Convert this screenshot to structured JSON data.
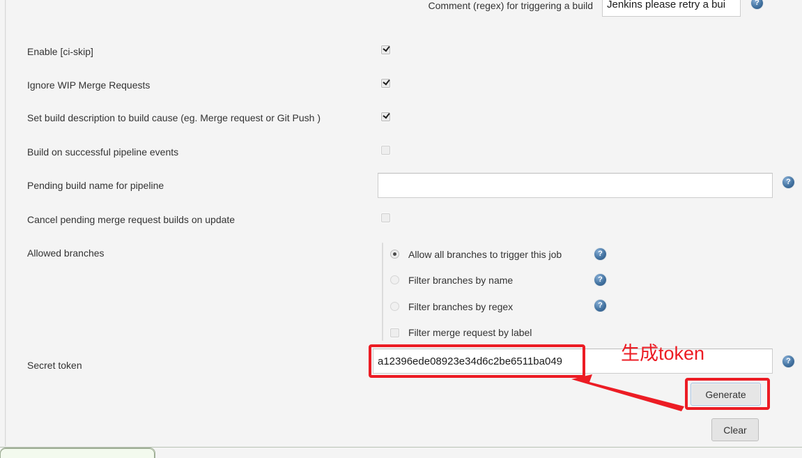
{
  "form": {
    "rows": [
      {
        "id": "comment-regex",
        "label": "Comment (regex) for triggering a build",
        "value": "Jenkins please retry a bui",
        "control": "text",
        "help": true
      },
      {
        "id": "enable-ci-skip",
        "label": "Enable [ci-skip]",
        "control": "checkbox",
        "checked": true,
        "help": false
      },
      {
        "id": "ignore-wip-merge-requests",
        "label": "Ignore WIP Merge Requests",
        "control": "checkbox",
        "checked": true,
        "help": false
      },
      {
        "id": "set-build-description",
        "label": "Set build description to build cause (eg. Merge request or Git Push )",
        "control": "checkbox",
        "checked": true,
        "help": false
      },
      {
        "id": "build-on-successful-pipeline-events",
        "label": "Build on successful pipeline events",
        "control": "checkbox",
        "checked": false,
        "help": false
      },
      {
        "id": "pending-build-name",
        "label": "Pending build name for pipeline",
        "value": "",
        "placeholder": "",
        "control": "text",
        "help": true
      },
      {
        "id": "cancel-pending-merge-request-builds",
        "label": "Cancel pending merge request builds on update",
        "control": "checkbox",
        "checked": false,
        "help": false
      },
      {
        "id": "allowed-branches",
        "label": "Allowed branches",
        "control": "radio-group",
        "help": false
      },
      {
        "id": "secret-token",
        "label": "Secret token",
        "value": "a12396ede08923e34d6c2be6511ba049",
        "control": "text",
        "help": true
      }
    ],
    "allowed_branches": {
      "options": [
        {
          "label": "Allow all branches to trigger this job",
          "selected": true,
          "type": "radio",
          "help": true
        },
        {
          "label": "Filter branches by name",
          "selected": false,
          "type": "radio",
          "help": true
        },
        {
          "label": "Filter branches by regex",
          "selected": false,
          "type": "radio",
          "help": true
        },
        {
          "label": "Filter merge request by label",
          "selected": false,
          "type": "checkbox",
          "help": false
        }
      ]
    },
    "buttons": {
      "generate": "Generate",
      "clear": "Clear"
    }
  },
  "annotations": {
    "callout_text": "生成token",
    "callout_color": "#ec1c24",
    "boxes": [
      {
        "name": "secret-token-highlight"
      },
      {
        "name": "generate-button-highlight"
      }
    ],
    "arrow": {
      "name": "arrow-to-token-field",
      "direction": "up-left"
    }
  },
  "icons": {
    "help": "help-question-icon",
    "help_glyph": "?"
  },
  "theme": {
    "page_background": "#f4f4f4",
    "text": "#333333",
    "input_background": "#ffffff",
    "input_border": "#cccccc",
    "button_background": "#e4e4e4",
    "help_icon_blue": "#41719f",
    "annotation_red": "#ec1c24",
    "green_panel": "#f3faee"
  }
}
